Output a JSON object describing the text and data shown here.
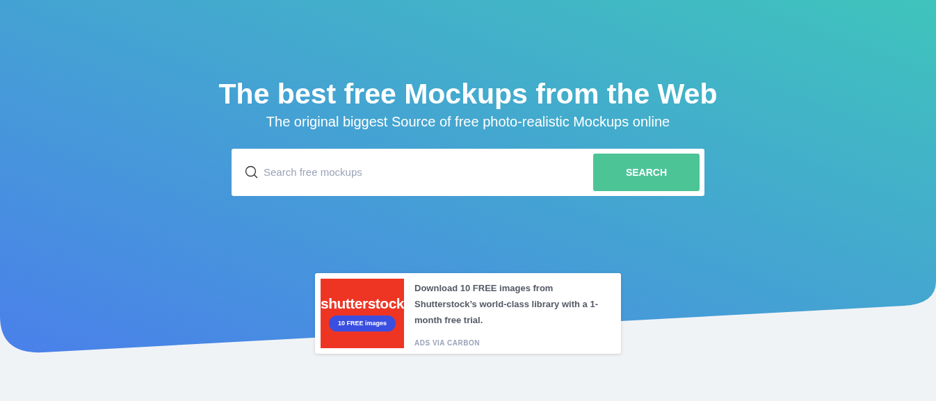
{
  "hero": {
    "title": "The best free Mockups from the Web",
    "subtitle": "The original biggest Source of free photo-realistic Mockups online"
  },
  "search": {
    "placeholder": "Search free mockups",
    "button": "SEARCH"
  },
  "ad": {
    "logo": "shutterstock",
    "badge": "10 FREE images",
    "text": "Download 10 FREE images from Shutterstock’s world-class library with a 1-month free trial.",
    "via": "ADS VIA CARBON"
  }
}
